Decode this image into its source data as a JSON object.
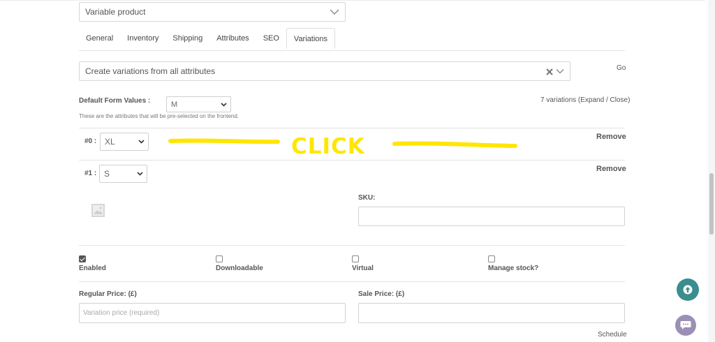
{
  "product_type": {
    "value": "Variable product"
  },
  "tabs": [
    {
      "label": "General"
    },
    {
      "label": "Inventory"
    },
    {
      "label": "Shipping"
    },
    {
      "label": "Attributes"
    },
    {
      "label": "SEO"
    },
    {
      "label": "Variations",
      "active": true
    }
  ],
  "bulk_action": {
    "value": "Create variations from all attributes",
    "go_label": "Go"
  },
  "default_form": {
    "label": "Default Form Values :",
    "selected": "M",
    "help": "These are the attributes that will be pre-selected on the frontend.",
    "variations_count": "7 variations",
    "expand_label": "(Expand",
    "separator": "/",
    "close_label": "Close)"
  },
  "variations": [
    {
      "index_label": "#0 :",
      "value": "XL",
      "remove_label": "Remove"
    },
    {
      "index_label": "#1 :",
      "value": "S",
      "remove_label": "Remove"
    }
  ],
  "annotation": {
    "text": "CLICK",
    "color": "#ffe600"
  },
  "sku": {
    "label": "SKU:",
    "value": ""
  },
  "options": [
    {
      "label": "Enabled",
      "checked": true
    },
    {
      "label": "Downloadable",
      "checked": false
    },
    {
      "label": "Virtual",
      "checked": false
    },
    {
      "label": "Manage stock?",
      "checked": false
    }
  ],
  "pricing": {
    "regular_label": "Regular Price: (£)",
    "regular_placeholder": "Variation price (required)",
    "sale_label": "Sale Price: (£)",
    "schedule_label": "Schedule"
  },
  "colors": {
    "teal": "#3b8d8f",
    "chat": "#9c8fb6"
  },
  "icons": {
    "scroll_top": "arrow-up-icon",
    "chat": "chat-icon"
  }
}
